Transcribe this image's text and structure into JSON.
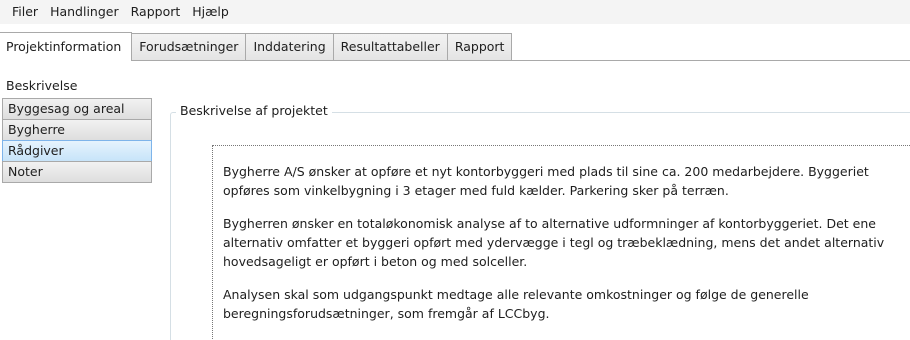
{
  "menu": [
    "Filer",
    "Handlinger",
    "Rapport",
    "Hjælp"
  ],
  "tabs": [
    "Projektinformation",
    "Forudsætninger",
    "Inddatering",
    "Resultattabeller",
    "Rapport"
  ],
  "sidetabs": [
    "Beskrivelse",
    "Byggesag og areal",
    "Bygherre",
    "Rådgiver",
    "Noter"
  ],
  "group_title": "Beskrivelse af projektet",
  "description_lines": [
    [
      "Bygherre A/S ønsker at opføre et nyt kontorbyggeri med plads til sine ca. 200 medarbejdere. Byggeriet",
      "opføres som vinkelbygning i 3 etager med fuld kælder. Parkering sker på terræn."
    ],
    [
      "Bygherren ønsker en totaløkonomisk analyse af to alternative udformninger af kontorbyggeriet. Det ene",
      "alternativ omfatter et byggeri opført med ydervægge i tegl og træbeklædning, mens det andet alternativ",
      "hovedsageligt er opført i beton og med solceller."
    ],
    [
      "Analysen skal som udgangspunkt medtage alle relevante omkostninger og følge de generelle",
      "beregningsforudsætninger, som fremgår af LCCbyg."
    ]
  ]
}
